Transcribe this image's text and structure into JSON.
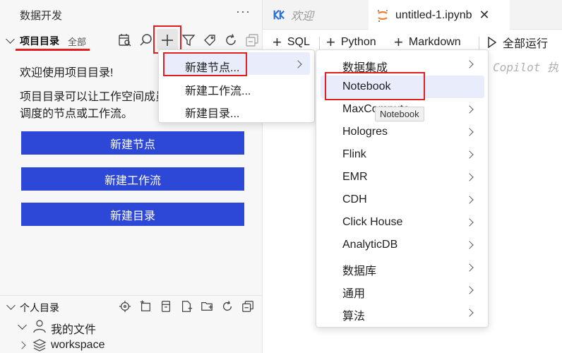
{
  "sidebar": {
    "header": "数据开发",
    "more": "···",
    "project": {
      "title": "项目目录",
      "all": "全部"
    },
    "welcome": "欢迎使用项目目录!",
    "description_line1": "项目目录可以让工作空间成员共享",
    "description_line2": "调度的节点或工作流。",
    "buttons": [
      "新建节点",
      "新建工作流",
      "新建目录"
    ],
    "personal": {
      "title": "个人目录",
      "items": [
        {
          "label": "我的文件",
          "icon": "user-icon"
        },
        {
          "label": "workspace",
          "icon": "layers-icon"
        }
      ]
    }
  },
  "tabs": {
    "welcome": "欢迎",
    "active": "untitled-1.ipynb",
    "close": "✕"
  },
  "toolbar": {
    "sql": "SQL",
    "python": "Python",
    "markdown": "Markdown",
    "run_all": "全部运行"
  },
  "copilot_hint": "Copilot 执",
  "menu_new": {
    "items": [
      "新建节点...",
      "新建工作流...",
      "新建目录..."
    ]
  },
  "menu_node": {
    "items": [
      "数据集成",
      "Notebook",
      "MaxCompute",
      "Hologres",
      "Flink",
      "EMR",
      "CDH",
      "Click House",
      "AnalyticDB",
      "数据库",
      "通用",
      "算法"
    ],
    "tooltip": "Notebook"
  },
  "colors": {
    "accent": "#2d47d6",
    "highlight_border": "#e02020",
    "menu_hover": "#e8ecfb"
  }
}
